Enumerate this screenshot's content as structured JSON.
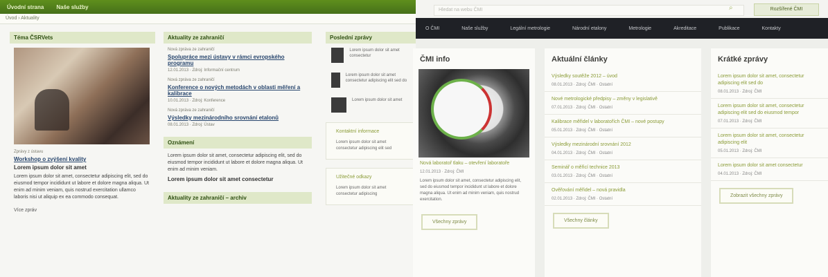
{
  "left": {
    "topbar": [
      "Úvodní strana",
      "Naše služby"
    ],
    "breadcrumb": "Úvod  ›  Aktuality",
    "col1": {
      "head": "Téma ČSRVets",
      "caption_small": "Zprávy z ústavu",
      "title_link": "Workshop o zvýšení kvality",
      "bold_line": "Lorem ipsum dolor sit amet",
      "body": "Lorem ipsum dolor sit amet, consectetur adipiscing elit, sed do eiusmod tempor incididunt ut labore et dolore magna aliqua. Ut enim ad minim veniam, quis nostrud exercitation ullamco laboris nisi ut aliquip ex ea commodo consequat.",
      "more": "Více zpráv"
    },
    "col2": {
      "head": "Aktuality ze zahraničí",
      "items": [
        {
          "meta": "Nová zpráva ze zahraničí",
          "title": "Spolupráce mezi ústavy v rámci evropského programu",
          "sub": "12.01.2013 · Zdroj: Informační centrum"
        },
        {
          "meta": "Nová zpráva ze zahraničí",
          "title": "Konference o nových metodách v oblasti měření a kalibrace",
          "sub": "10.01.2013 · Zdroj: Konference"
        },
        {
          "meta": "Nová zpráva ze zahraničí",
          "title": "Výsledky mezinárodního srovnání etalonů",
          "sub": "08.01.2013 · Zdroj: Ústav"
        }
      ],
      "head2": "Oznámení",
      "text2": "Lorem ipsum dolor sit amet, consectetur adipiscing elit, sed do eiusmod tempor incididunt ut labore et dolore magna aliqua. Ut enim ad minim veniam.",
      "bold2": "Lorem ipsum dolor sit amet consectetur",
      "head3": "Aktuality ze zahraničí – archiv"
    },
    "col3": {
      "head": "Poslední zprávy",
      "thumbs": [
        "Lorem ipsum dolor sit amet consectetur",
        "Lorem ipsum dolor sit amet consectetur adipiscing elit sed do",
        "Lorem ipsum dolor sit amet"
      ],
      "side1_head": "Kontaktní informace",
      "side1_text": "Lorem ipsum dolor sit amet consectetur adipiscing elit sed",
      "side2_head": "Užitečné odkazy",
      "side2_text": "Lorem ipsum dolor sit amet consectetur adipiscing"
    }
  },
  "right": {
    "search_placeholder": "Hledat na webu ČMI",
    "top_button": "Rozšířené ČMI",
    "nav": [
      "O ČMI",
      "Naše služby",
      "Legální metrologie",
      "Národní etalony",
      "Metrologie",
      "Akreditace",
      "Publikace",
      "Kontakty"
    ],
    "col1": {
      "head": "ČMI info",
      "caption": "Nová laboratoř tlaku – otevření laboratoře",
      "meta": "12.01.2013 · Zdroj: ČMI",
      "text": "Lorem ipsum dolor sit amet, consectetur adipiscing elit, sed do eiusmod tempor incididunt ut labore et dolore magna aliqua. Ut enim ad minim veniam, quis nostrud exercitation.",
      "button": "Všechny zprávy"
    },
    "col2": {
      "head": "Aktuální články",
      "items": [
        {
          "title": "Výsledky soutěže 2012 – úvod",
          "meta": "08.01.2013 · Zdroj: ČMI · Ostatní"
        },
        {
          "title": "Nové metrologické předpisy – změny v legislativě",
          "meta": "07.01.2013 · Zdroj: ČMI · Ostatní"
        },
        {
          "title": "Kalibrace měřidel v laboratořích ČMI – nové postupy",
          "meta": "05.01.2013 · Zdroj: ČMI · Ostatní"
        },
        {
          "title": "Výsledky mezinárodní srovnání 2012",
          "meta": "04.01.2013 · Zdroj: ČMI · Ostatní"
        },
        {
          "title": "Seminář o měřicí technice 2013",
          "meta": "03.01.2013 · Zdroj: ČMI · Ostatní"
        },
        {
          "title": "Ověřování měřidel – nová pravidla",
          "meta": "02.01.2013 · Zdroj: ČMI · Ostatní"
        }
      ],
      "button": "Všechny články"
    },
    "col3": {
      "head": "Krátké zprávy",
      "items": [
        {
          "title": "Lorem ipsum dolor sit amet, consectetur adipiscing elit sed do",
          "meta": "08.01.2013 · Zdroj: ČMI"
        },
        {
          "title": "Lorem ipsum dolor sit amet, consectetur adipiscing elit sed do eiusmod tempor",
          "meta": "07.01.2013 · Zdroj: ČMI"
        },
        {
          "title": "Lorem ipsum dolor sit amet, consectetur adipiscing elit",
          "meta": "05.01.2013 · Zdroj: ČMI"
        },
        {
          "title": "Lorem ipsum dolor sit amet consectetur",
          "meta": "04.01.2013 · Zdroj: ČMI"
        }
      ],
      "button": "Zobrazit všechny zprávy"
    }
  }
}
